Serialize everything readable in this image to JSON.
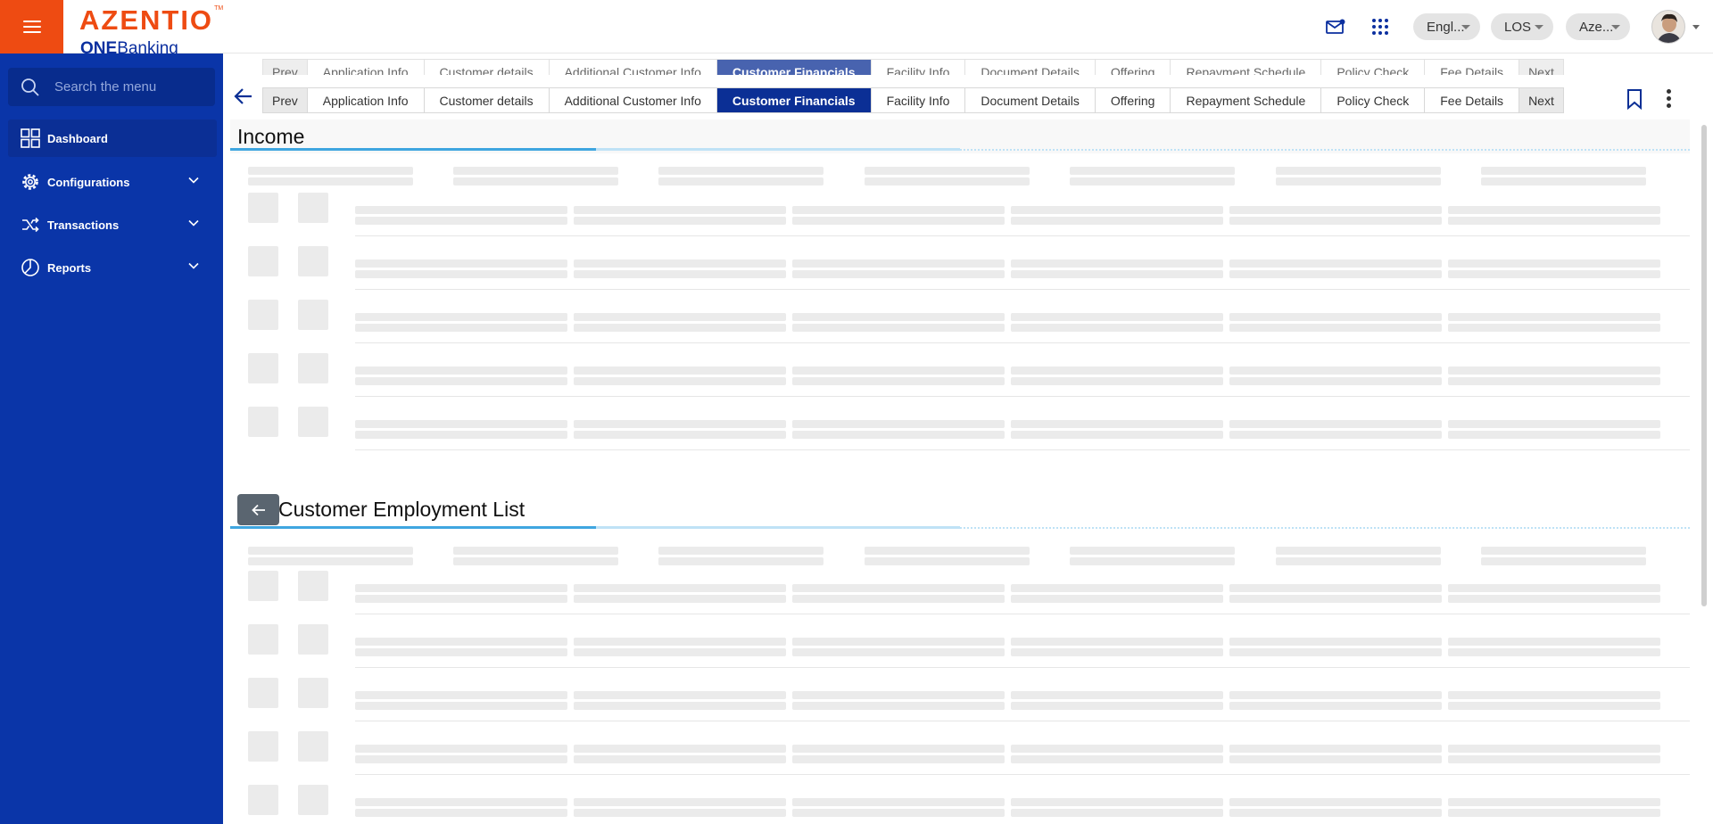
{
  "header": {
    "logo": {
      "main": "AZENTIO",
      "tm": "TM",
      "sub_bold": "ONE",
      "sub_rest": "Banking"
    },
    "language": "Engl...",
    "module": "LOS",
    "entity": "Aze..."
  },
  "sidebar": {
    "search_placeholder": "Search the menu",
    "items": [
      {
        "label": "Dashboard",
        "icon": "dashboard-grid-icon"
      },
      {
        "label": "Configurations",
        "icon": "gear-icon"
      },
      {
        "label": "Transactions",
        "icon": "shuffle-icon"
      },
      {
        "label": "Reports",
        "icon": "pie-chart-icon"
      }
    ]
  },
  "tabs": {
    "prev": "Prev",
    "next": "Next",
    "items": [
      "Application Info",
      "Customer details",
      "Additional Customer Info",
      "Customer Financials",
      "Facility Info",
      "Document Details",
      "Offering",
      "Repayment Schedule",
      "Policy Check",
      "Fee Details"
    ],
    "current": "Customer Financials"
  },
  "sections": {
    "income_title": "Income",
    "employment_title": "Customer Employment List"
  },
  "colors": {
    "brand_orange": "#ee4b12",
    "sidebar_blue": "#0a35a8",
    "active_tab": "#0b2f95",
    "accent_underline": "#3fa6e0"
  }
}
